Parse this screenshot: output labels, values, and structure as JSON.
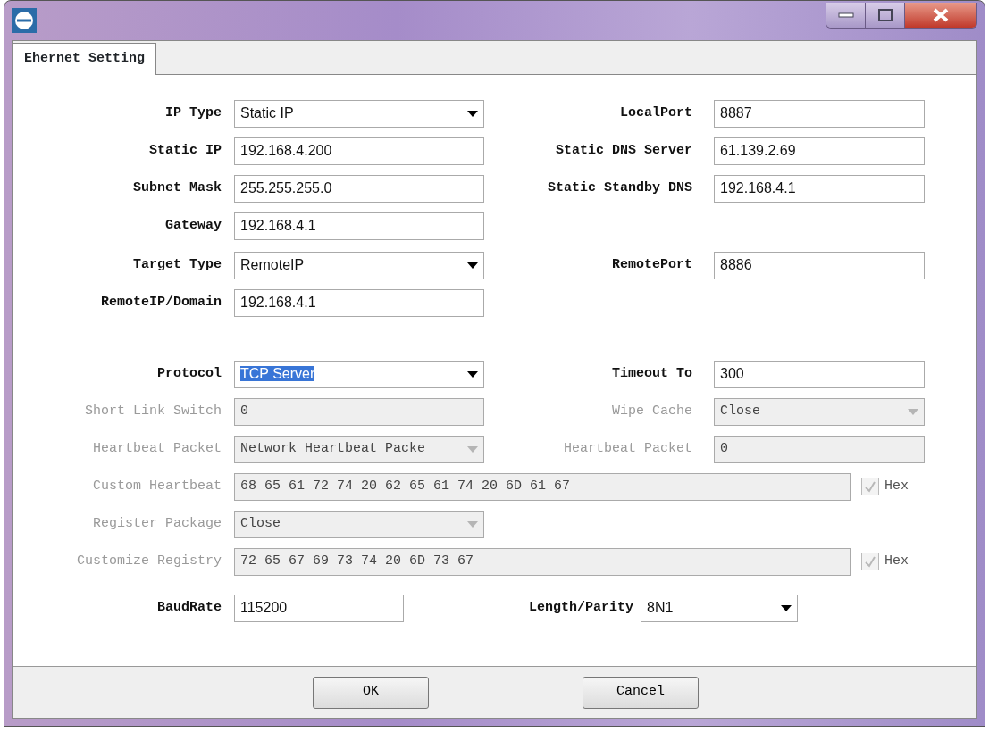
{
  "tabs": [
    {
      "label": "Ehernet Setting",
      "selected": true
    }
  ],
  "groups": [
    {
      "rows": [
        {
          "kind": "pair",
          "left": {
            "label": "IP Type",
            "kind": "combo",
            "value": "Static IP",
            "disabled": false,
            "highlighted": false
          },
          "right": {
            "label": "LocalPort",
            "kind": "text",
            "value": "8887",
            "disabled": false
          }
        },
        {
          "kind": "pair",
          "left": {
            "label": "Static IP",
            "kind": "text",
            "value": "192.168.4.200",
            "disabled": false
          },
          "right": {
            "label": "Static DNS Server",
            "kind": "text",
            "value": "61.139.2.69",
            "disabled": false
          }
        },
        {
          "kind": "pair",
          "left": {
            "label": "Subnet Mask",
            "kind": "text",
            "value": "255.255.255.0",
            "disabled": false
          },
          "right": {
            "label": "Static Standby DNS",
            "kind": "text",
            "value": "192.168.4.1",
            "disabled": false
          }
        },
        {
          "kind": "pair",
          "left": {
            "label": "Gateway",
            "kind": "text",
            "value": "192.168.4.1",
            "disabled": false
          }
        }
      ]
    },
    {
      "rows": [
        {
          "kind": "pair",
          "left": {
            "label": "Target Type",
            "kind": "combo",
            "value": "RemoteIP",
            "disabled": false,
            "highlighted": false
          },
          "right": {
            "label": "RemotePort",
            "kind": "text",
            "value": "8886",
            "disabled": false
          }
        },
        {
          "kind": "pair",
          "left": {
            "label": "RemoteIP/Domain",
            "kind": "text",
            "value": "192.168.4.1",
            "disabled": false
          }
        }
      ]
    },
    {
      "rows": [
        {
          "kind": "pair",
          "left": {
            "label": "Protocol",
            "kind": "combo",
            "value": "TCP Server",
            "disabled": false,
            "highlighted": true
          },
          "right": {
            "label": "Timeout To",
            "kind": "text",
            "value": "300",
            "disabled": false
          }
        },
        {
          "kind": "pair",
          "left": {
            "label": "Short Link Switch",
            "kind": "text",
            "value": "0",
            "disabled": true
          },
          "right": {
            "label": "Wipe Cache",
            "kind": "combo",
            "value": "Close",
            "disabled": true,
            "highlighted": false
          }
        },
        {
          "kind": "pair",
          "left": {
            "label": "Heartbeat Packet",
            "kind": "combo",
            "value": "Network Heartbeat Packe",
            "disabled": true,
            "highlighted": false
          },
          "right": {
            "label": "Heartbeat Packet",
            "kind": "text",
            "value": "0",
            "disabled": true
          }
        },
        {
          "kind": "wide",
          "left": {
            "label": "Custom Heartbeat",
            "kind": "text",
            "value": "68 65 61 72 74 20 62 65 61 74 20 6D 61 67",
            "disabled": true
          },
          "hex": {
            "label": "Hex",
            "checked": true,
            "disabled": true
          }
        },
        {
          "kind": "pair",
          "left": {
            "label": "Register Package",
            "kind": "combo",
            "value": "Close",
            "disabled": true,
            "highlighted": false
          }
        },
        {
          "kind": "wide",
          "left": {
            "label": "Customize Registry",
            "kind": "text",
            "value": "72 65 67 69 73 74 20 6D 73 67",
            "disabled": true
          },
          "hex": {
            "label": "Hex",
            "checked": true,
            "disabled": true
          }
        }
      ]
    },
    {
      "rows": [
        {
          "kind": "serial",
          "left": {
            "label": "BaudRate",
            "kind": "text",
            "value": "115200",
            "disabled": false
          },
          "right": {
            "label": "Length/Parity",
            "kind": "combo",
            "value": "8N1",
            "disabled": false,
            "highlighted": false
          }
        }
      ]
    }
  ],
  "buttons": [
    "OK",
    "Cancel"
  ]
}
